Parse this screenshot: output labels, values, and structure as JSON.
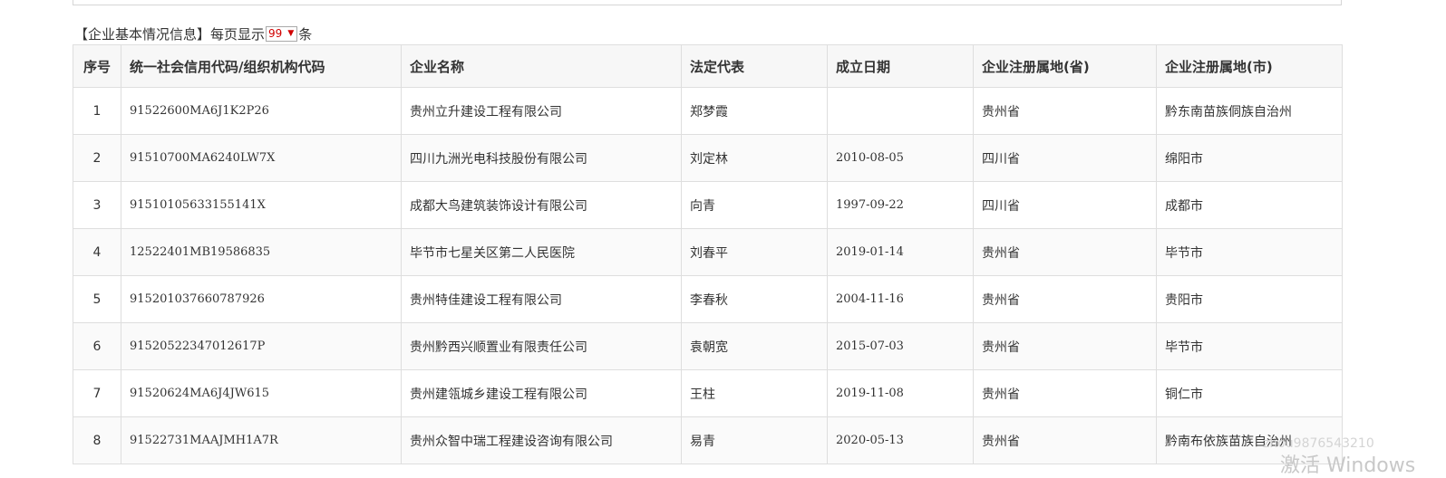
{
  "caption": {
    "title": "【企业基本情况信息】",
    "per_page_prefix": "每页显示",
    "per_page_value": "99",
    "per_page_suffix": "条"
  },
  "table": {
    "headers": [
      "序号",
      "统一社会信用代码/组织机构代码",
      "企业名称",
      "法定代表",
      "成立日期",
      "企业注册属地(省)",
      "企业注册属地(市)"
    ],
    "rows": [
      {
        "idx": "1",
        "code": "91522600MA6J1K2P26",
        "name": "贵州立升建设工程有限公司",
        "rep": "郑梦霞",
        "date": "",
        "province": "贵州省",
        "city": "黔东南苗族侗族自治州"
      },
      {
        "idx": "2",
        "code": "91510700MA6240LW7X",
        "name": "四川九洲光电科技股份有限公司",
        "rep": "刘定林",
        "date": "2010-08-05",
        "province": "四川省",
        "city": "绵阳市"
      },
      {
        "idx": "3",
        "code": "91510105633155141X",
        "name": "成都大鸟建筑装饰设计有限公司",
        "rep": "向青",
        "date": "1997-09-22",
        "province": "四川省",
        "city": "成都市"
      },
      {
        "idx": "4",
        "code": "12522401MB19586835",
        "name": "毕节市七星关区第二人民医院",
        "rep": "刘春平",
        "date": "2019-01-14",
        "province": "贵州省",
        "city": "毕节市"
      },
      {
        "idx": "5",
        "code": "915201037660787926",
        "name": "贵州特佳建设工程有限公司",
        "rep": "李春秋",
        "date": "2004-11-16",
        "province": "贵州省",
        "city": "贵阳市"
      },
      {
        "idx": "6",
        "code": "91520522347012617P",
        "name": "贵州黔西兴顺置业有限责任公司",
        "rep": "袁朝宽",
        "date": "2015-07-03",
        "province": "贵州省",
        "city": "毕节市"
      },
      {
        "idx": "7",
        "code": "91520624MA6J4JW615",
        "name": "贵州建瓴城乡建设工程有限公司",
        "rep": "王柱",
        "date": "2019-11-08",
        "province": "贵州省",
        "city": "铜仁市"
      },
      {
        "idx": "8",
        "code": "91522731MAAJMH1A7R",
        "name": "贵州众智中瑞工程建设咨询有限公司",
        "rep": "易青",
        "date": "2020-05-13",
        "province": "贵州省",
        "city": "黔南布依族苗族自治州"
      }
    ]
  },
  "watermarks": {
    "user": "zhou9876543210",
    "windows": "激活 Windows"
  }
}
